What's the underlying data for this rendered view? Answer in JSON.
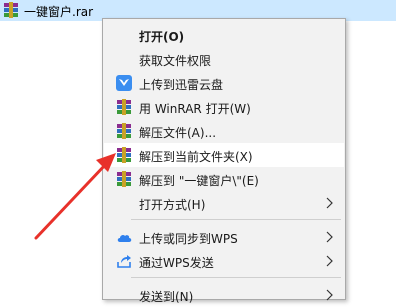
{
  "file": {
    "name": "一键窗户.rar",
    "icon": "winrar-archive-icon"
  },
  "menu": {
    "items": [
      {
        "label": "打开(O)",
        "bold": true,
        "icon": null
      },
      {
        "label": "获取文件权限",
        "icon": null
      },
      {
        "label": "上传到迅雷云盘",
        "icon": "xunlei-cloud-icon"
      },
      {
        "label": "用 WinRAR 打开(W)",
        "icon": "winrar-icon"
      },
      {
        "label": "解压文件(A)...",
        "icon": "winrar-icon"
      },
      {
        "label": "解压到当前文件夹(X)",
        "icon": "winrar-icon",
        "highlighted": true
      },
      {
        "label": "解压到 \"一键窗户\\\"(E)",
        "icon": "winrar-icon"
      },
      {
        "label": "打开方式(H)",
        "icon": null,
        "submenu": true
      },
      {
        "label": "上传或同步到WPS",
        "icon": "wps-cloud-icon",
        "submenu": true
      },
      {
        "label": "通过WPS发送",
        "icon": "wps-share-icon",
        "submenu": true
      },
      {
        "label": "发送到(N)",
        "icon": null,
        "submenu": true
      }
    ]
  },
  "colors": {
    "selection": "#cce8ff",
    "menu_bg": "#f2f2f2",
    "hover": "#ffffff",
    "arrow": "#e8312a"
  }
}
